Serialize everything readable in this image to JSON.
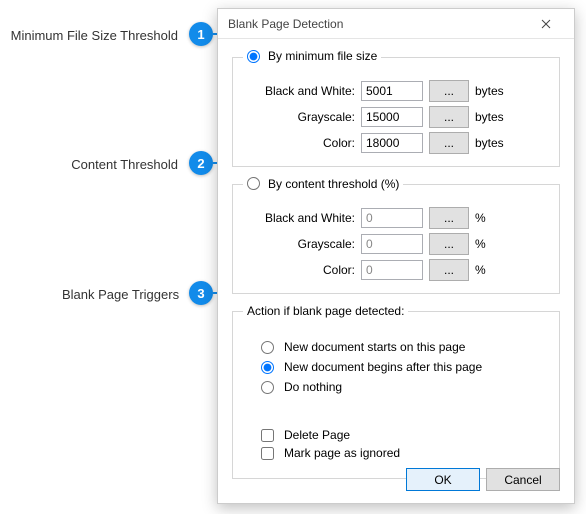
{
  "callouts": {
    "c1": {
      "num": "1",
      "label": "Minimum File Size Threshold"
    },
    "c2": {
      "num": "2",
      "label": "Content Threshold"
    },
    "c3": {
      "num": "3",
      "label": "Blank Page Triggers"
    }
  },
  "dialog": {
    "title": "Blank Page Detection",
    "group_filesize": {
      "legend": "By minimum file size",
      "rows": {
        "bw": {
          "label": "Black and White:",
          "value": "5001",
          "unit": "bytes"
        },
        "gray": {
          "label": "Grayscale:",
          "value": "15000",
          "unit": "bytes"
        },
        "color": {
          "label": "Color:",
          "value": "18000",
          "unit": "bytes"
        }
      },
      "browse": "..."
    },
    "group_content": {
      "legend": "By content threshold (%)",
      "rows": {
        "bw": {
          "label": "Black and White:",
          "value": "0",
          "unit": "%"
        },
        "gray": {
          "label": "Grayscale:",
          "value": "0",
          "unit": "%"
        },
        "color": {
          "label": "Color:",
          "value": "0",
          "unit": "%"
        }
      },
      "browse": "..."
    },
    "group_action": {
      "legend": "Action if blank page detected:",
      "opts": {
        "starts_on": "New document starts on this page",
        "after": "New document begins after this page",
        "nothing": "Do nothing"
      },
      "checks": {
        "delete": "Delete Page",
        "ignored": "Mark page as ignored"
      }
    },
    "buttons": {
      "ok": "OK",
      "cancel": "Cancel"
    }
  }
}
